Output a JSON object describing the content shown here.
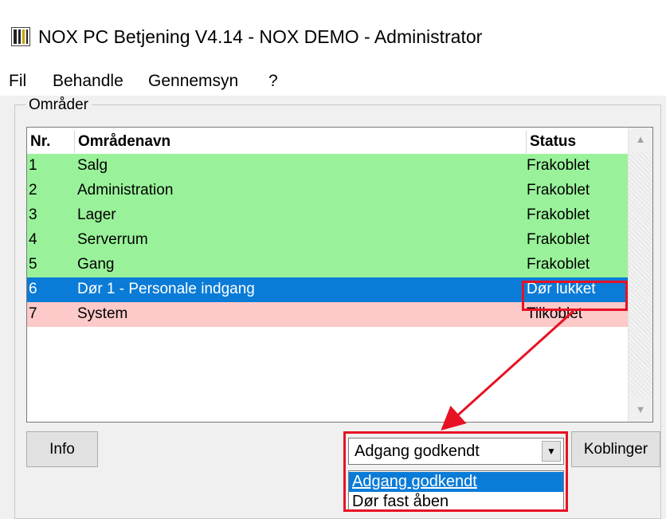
{
  "window": {
    "title": "NOX PC Betjening V4.14 - NOX DEMO - Administrator",
    "icon": "nox-app-icon"
  },
  "menu": {
    "items": [
      {
        "label": "Fil"
      },
      {
        "label": "Behandle"
      },
      {
        "label": "Gennemsyn"
      },
      {
        "label": "?"
      }
    ]
  },
  "areas": {
    "group_label": "Områder",
    "columns": {
      "nr": "Nr.",
      "name": "Områdenavn",
      "status": "Status"
    },
    "rows": [
      {
        "nr": "1",
        "name": "Salg",
        "status": "Frakoblet",
        "color": "#99f29a"
      },
      {
        "nr": "2",
        "name": "Administration",
        "status": "Frakoblet",
        "color": "#99f29a"
      },
      {
        "nr": "3",
        "name": "Lager",
        "status": "Frakoblet",
        "color": "#99f29a"
      },
      {
        "nr": "4",
        "name": "Serverrum",
        "status": "Frakoblet",
        "color": "#99f29a"
      },
      {
        "nr": "5",
        "name": "Gang",
        "status": "Frakoblet",
        "color": "#99f29a"
      },
      {
        "nr": "6",
        "name": "Dør 1 - Personale indgang",
        "status": "Dør lukket",
        "color": "#0a7bd7"
      },
      {
        "nr": "7",
        "name": "System",
        "status": "Tilkoblet",
        "color": "#fdc9c9"
      }
    ]
  },
  "buttons": {
    "info": "Info",
    "koblinger": "Koblinger"
  },
  "combo": {
    "selected": "Adgang godkendt",
    "options": [
      "Adgang godkendt",
      "Dør fast åben"
    ]
  },
  "colors": {
    "highlight": "#e81123",
    "selection": "#0a7bd7",
    "disarmed": "#99f29a",
    "armed": "#fdc9c9"
  }
}
